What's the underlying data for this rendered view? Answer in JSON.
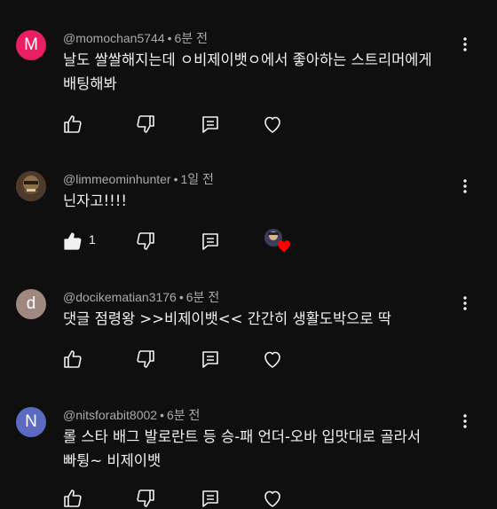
{
  "colors": {
    "background": "#0f0f0f",
    "text": "#f1f1f1",
    "meta": "#aaaaaa",
    "avatar_m": "#e91e63",
    "avatar_d": "#a1887f",
    "avatar_n": "#5c6bc0",
    "heart": "#ff0000"
  },
  "comments": [
    {
      "avatar_letter": "M",
      "author": "@momochan5744",
      "time": "6분 전",
      "text": "날도 쌀쌀해지는데 ㅇ비제이뱃ㅇ에서 좋아하는 스트리머에게\n배팅해봐",
      "likes": "",
      "liked": false
    },
    {
      "avatar_letter": "",
      "author": "@limmeominhunter",
      "time": "1일 전",
      "text": "닌자고!!!!",
      "likes": "1",
      "liked": true,
      "creator_heart": true
    },
    {
      "avatar_letter": "d",
      "author": "@docikematian3176",
      "time": "6분 전",
      "text": "댓글 점령왕 >>비제이뱃<< 간간히 생활도박으로 딱",
      "likes": "",
      "liked": false
    },
    {
      "avatar_letter": "N",
      "author": "@nitsforabit8002",
      "time": "6분 전",
      "text": "롤 스타 배그 발로란트 등 승-패 언더-오바 입맛대로 골라서\n빠튕~ 비제이뱃",
      "likes": "",
      "liked": false
    }
  ],
  "icons": {
    "like": "thumbs-up-icon",
    "dislike": "thumbs-down-icon",
    "reply": "reply-comment-icon",
    "heart": "heart-icon",
    "more": "more-vertical-icon"
  },
  "separator": "•"
}
